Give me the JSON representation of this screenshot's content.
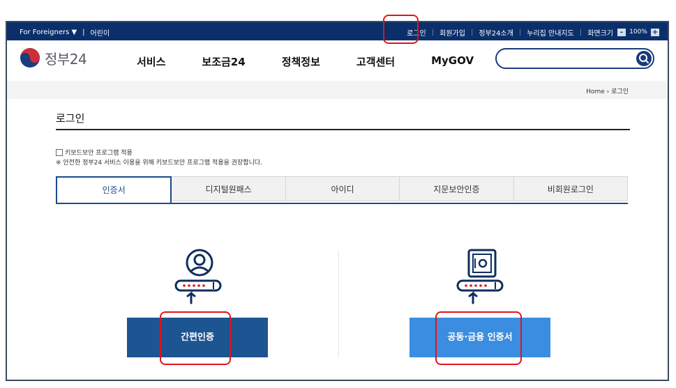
{
  "topbar": {
    "for_foreigners": "For Foreigners ▼",
    "kids": "어린이",
    "links": [
      "로그인",
      "회원가입",
      "정부24소개",
      "누리집 안내지도",
      "화면크기"
    ],
    "zoom": {
      "minus": "-",
      "value": "100%",
      "plus": "+"
    }
  },
  "header": {
    "logo_text": "정부24",
    "nav": [
      "서비스",
      "보조금24",
      "정책정보",
      "고객센터",
      "MyGOV"
    ],
    "search_placeholder": ""
  },
  "breadcrumb": {
    "home": "Home",
    "sep": "›",
    "current": "로그인"
  },
  "page": {
    "title": "로그인",
    "keyboard_security_label": "키보드보안 프로그램 적용",
    "keyboard_security_note": "※ 안전한 정부24 서비스 이용을 위해 키보드보안 프로그램 적용을 권장합니다."
  },
  "tabs": [
    {
      "label": "인증서",
      "active": true
    },
    {
      "label": "디지털원패스",
      "active": false
    },
    {
      "label": "아이디",
      "active": false
    },
    {
      "label": "지문보안인증",
      "active": false
    },
    {
      "label": "비회원로그인",
      "active": false
    }
  ],
  "login_options": {
    "simple_auth_label": "간편인증",
    "joint_cert_label": "공동·금융 인증서"
  },
  "colors": {
    "topbar_bg": "#0b2f6b",
    "primary_dark": "#1d5492",
    "primary_light": "#3a8de0",
    "annotation_red": "#e0141b"
  }
}
